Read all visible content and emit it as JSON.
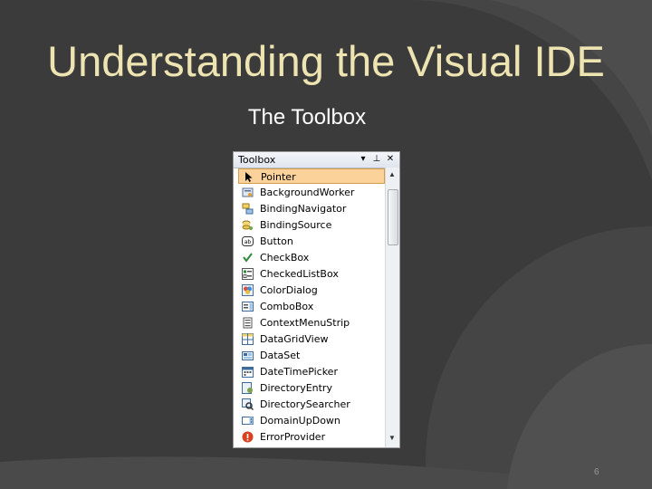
{
  "slide": {
    "title": "Understanding the Visual IDE",
    "subtitle": "The Toolbox",
    "page_number": "6"
  },
  "toolbox": {
    "title": "Toolbox",
    "buttons": {
      "dropdown": "▾",
      "pin": "⊥",
      "close": "✕"
    },
    "items": [
      {
        "label": "Pointer",
        "icon": "pointer-icon",
        "selected": true
      },
      {
        "label": "BackgroundWorker",
        "icon": "background-worker-icon"
      },
      {
        "label": "BindingNavigator",
        "icon": "binding-navigator-icon"
      },
      {
        "label": "BindingSource",
        "icon": "binding-source-icon"
      },
      {
        "label": "Button",
        "icon": "button-icon"
      },
      {
        "label": "CheckBox",
        "icon": "checkbox-icon"
      },
      {
        "label": "CheckedListBox",
        "icon": "checked-listbox-icon"
      },
      {
        "label": "ColorDialog",
        "icon": "color-dialog-icon"
      },
      {
        "label": "ComboBox",
        "icon": "combobox-icon"
      },
      {
        "label": "ContextMenuStrip",
        "icon": "context-menu-strip-icon"
      },
      {
        "label": "DataGridView",
        "icon": "data-grid-view-icon"
      },
      {
        "label": "DataSet",
        "icon": "dataset-icon"
      },
      {
        "label": "DateTimePicker",
        "icon": "date-time-picker-icon"
      },
      {
        "label": "DirectoryEntry",
        "icon": "directory-entry-icon"
      },
      {
        "label": "DirectorySearcher",
        "icon": "directory-searcher-icon"
      },
      {
        "label": "DomainUpDown",
        "icon": "domain-updown-icon"
      },
      {
        "label": "ErrorProvider",
        "icon": "error-provider-icon"
      }
    ]
  }
}
